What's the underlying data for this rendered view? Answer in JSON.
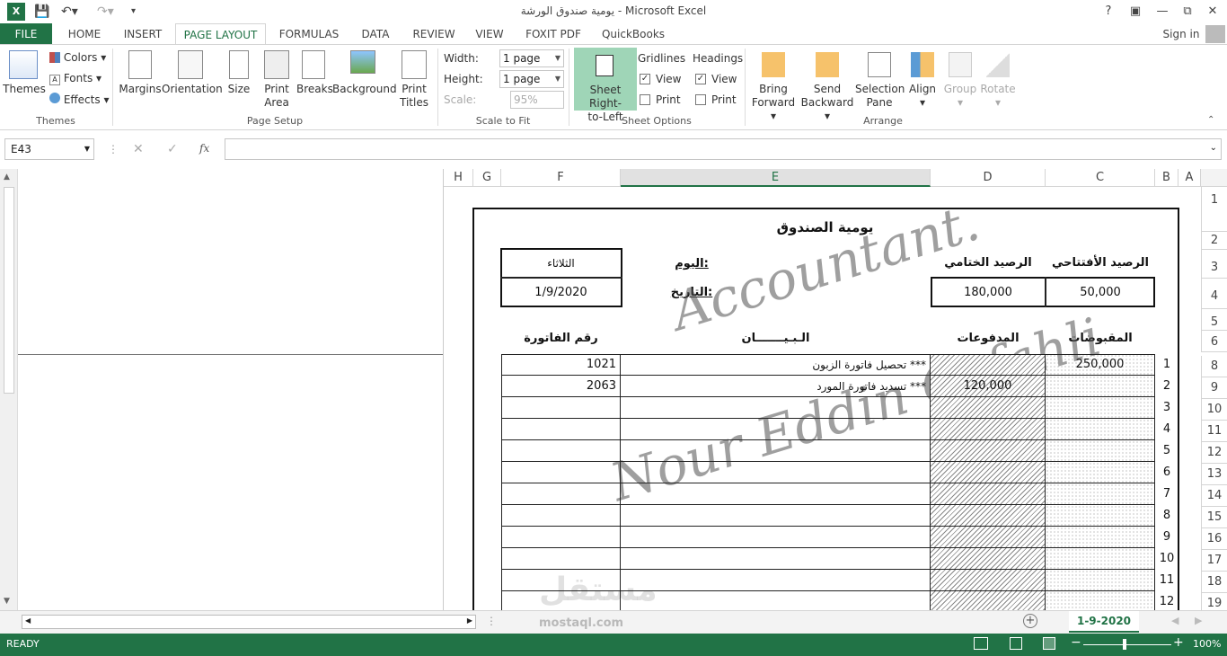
{
  "window": {
    "title": "يومية صندوق الورشة - Microsoft Excel",
    "help": "?",
    "sign_in": "Sign in"
  },
  "tabs": [
    "FILE",
    "HOME",
    "INSERT",
    "PAGE LAYOUT",
    "FORMULAS",
    "DATA",
    "REVIEW",
    "VIEW",
    "FOXIT PDF",
    "QuickBooks"
  ],
  "active_tab": "PAGE LAYOUT",
  "ribbon": {
    "themes": {
      "themes": "Themes",
      "colors": "Colors",
      "fonts": "Fonts",
      "effects": "Effects",
      "group": "Themes"
    },
    "page_setup": {
      "margins": "Margins",
      "orientation": "Orientation",
      "size": "Size",
      "print_area_1": "Print",
      "print_area_2": "Area",
      "breaks": "Breaks",
      "background": "Background",
      "print_titles_1": "Print",
      "print_titles_2": "Titles",
      "group": "Page Setup"
    },
    "scale": {
      "width_label": "Width:",
      "width_value": "1 page",
      "height_label": "Height:",
      "height_value": "1 page",
      "scale_label": "Scale:",
      "scale_value": "95%",
      "group": "Scale to Fit"
    },
    "sheet_options": {
      "rtl_1": "Sheet Right-",
      "rtl_2": "to-Left",
      "gridlines": "Gridlines",
      "headings": "Headings",
      "view": "View",
      "print": "Print",
      "group": "Sheet Options"
    },
    "arrange": {
      "bring_1": "Bring",
      "bring_2": "Forward",
      "send_1": "Send",
      "send_2": "Backward",
      "sel_1": "Selection",
      "sel_2": "Pane",
      "align": "Align",
      "group_btn": "Group",
      "rotate": "Rotate",
      "group": "Arrange"
    }
  },
  "formula_bar": {
    "name_box": "E43",
    "fx": "fx",
    "formula": ""
  },
  "columns": [
    "A",
    "B",
    "C",
    "D",
    "E",
    "F",
    "G",
    "H"
  ],
  "rows": [
    "1",
    "2",
    "3",
    "4",
    "5",
    "6",
    "8",
    "9",
    "10",
    "11",
    "12",
    "13",
    "14",
    "15",
    "16",
    "17",
    "18",
    "19"
  ],
  "sheet_content": {
    "title": "يومية الصندوق",
    "opening_balance_label": "الرصيد الأفتتاحي",
    "closing_balance_label": "الرصيد الختامي",
    "opening_balance": "50,000",
    "closing_balance": "180,000",
    "day_label": "اليوم:",
    "date_label": "التاريخ:",
    "day_value": "الثلاثاء",
    "date_value": "1/9/2020",
    "headers": {
      "receipts": "المقبوضات",
      "payments": "المدفوعات",
      "statement": "الـبـيـــــــان",
      "invoice": "رقم الفاتورة"
    },
    "rows": [
      {
        "num": "1",
        "receipts": "250,000",
        "payments": "",
        "statement": "تحصيل فاتورة الزبون ***",
        "invoice": "1021"
      },
      {
        "num": "2",
        "receipts": "",
        "payments": "120,000",
        "statement": "تسديد فاتورة المورد ***",
        "invoice": "2063"
      },
      {
        "num": "3"
      },
      {
        "num": "4"
      },
      {
        "num": "5"
      },
      {
        "num": "6"
      },
      {
        "num": "7"
      },
      {
        "num": "8"
      },
      {
        "num": "9"
      },
      {
        "num": "10"
      },
      {
        "num": "11"
      },
      {
        "num": "12"
      }
    ],
    "watermark_1": "Accountant.",
    "watermark_2": "Nour Eddin Orfahli",
    "watermark_brand_ar": "مستقل",
    "watermark_brand": "mostaql.com"
  },
  "sheet_tab": "1-9-2020",
  "status": {
    "ready": "READY",
    "zoom": "100%"
  },
  "colors": {
    "excel_green": "#217346"
  }
}
